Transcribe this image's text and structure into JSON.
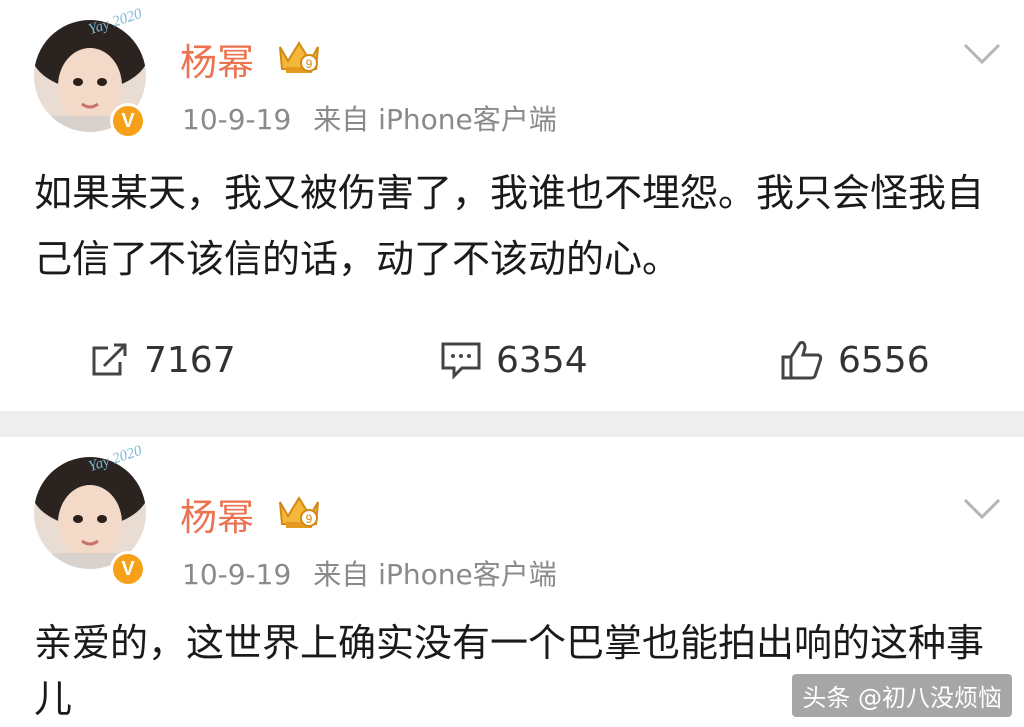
{
  "posts": [
    {
      "username": "杨幂",
      "date": "10-9-19",
      "source": "来自 iPhone客户端",
      "text": "如果某天，我又被伤害了，我谁也不埋怨。我只会怪我自己信了不该信的话，动了不该动的心。",
      "actions": {
        "repost": "7167",
        "comment": "6354",
        "like": "6556"
      }
    },
    {
      "username": "杨幂",
      "date": "10-9-19",
      "source": "来自 iPhone客户端",
      "text": "亲爱的，这世界上确实没有一个巴掌也能拍出响的这种事儿"
    }
  ],
  "avatar_badge": "V",
  "avatar_sticker_text": "Yay 2020",
  "vip_level": "9",
  "watermark": "头条 @初八没烦恼",
  "colors": {
    "username": "#eb7350",
    "meta": "#8a8a8a",
    "verified": "#f7a11a",
    "divider": "#eeeeee"
  }
}
